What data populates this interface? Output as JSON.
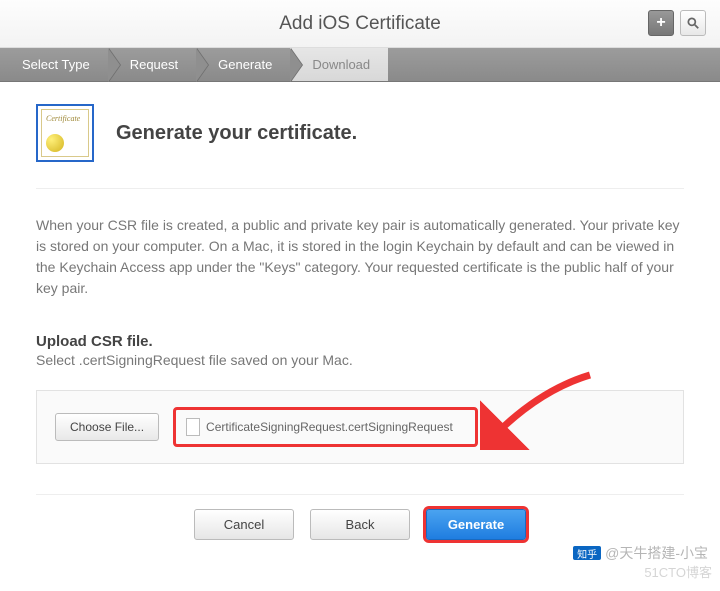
{
  "header": {
    "title": "Add iOS Certificate"
  },
  "steps": {
    "s1": "Select Type",
    "s2": "Request",
    "s3": "Generate",
    "s4": "Download"
  },
  "icon_label": "Certificate",
  "main_heading": "Generate your certificate.",
  "description": "When your CSR file is created, a public and private key pair is automatically generated. Your private key is stored on your computer. On a Mac, it is stored in the login Keychain by default and can be viewed in the Keychain Access app under the \"Keys\" category. Your requested certificate is the public half of your key pair.",
  "upload": {
    "title": "Upload CSR file.",
    "subtitle": "Select .certSigningRequest file saved on your Mac.",
    "choose_label": "Choose File...",
    "filename": "CertificateSigningRequest.certSigningRequest"
  },
  "footer": {
    "cancel": "Cancel",
    "back": "Back",
    "generate": "Generate"
  },
  "watermark": {
    "zhihu": "知乎",
    "author": "@天牛搭建-小宝",
    "blog": "51CTO博客"
  }
}
